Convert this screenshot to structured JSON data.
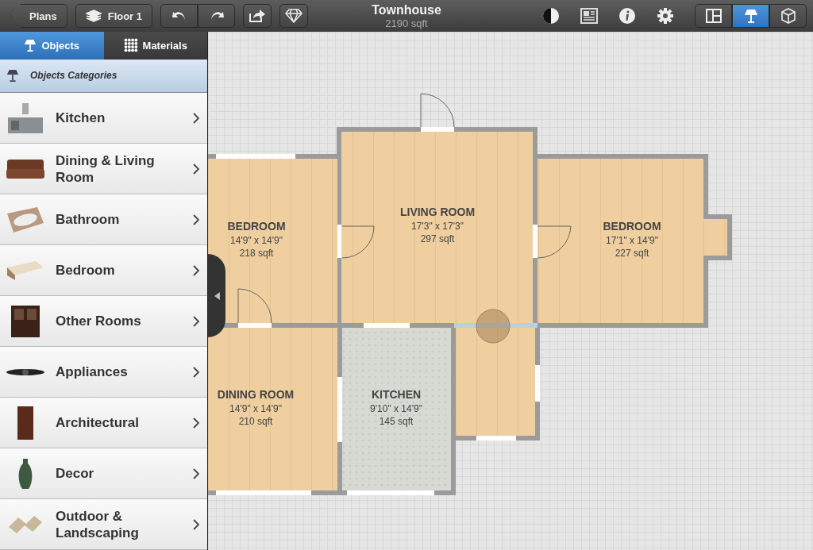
{
  "toolbar": {
    "back_button": "Plans",
    "floor_button": "Floor 1",
    "title": "Townhouse",
    "subtitle": "2190 sqft",
    "view_modes": [
      {
        "kind": "plan",
        "selected": false
      },
      {
        "kind": "objects",
        "selected": true
      },
      {
        "kind": "cube",
        "selected": false
      }
    ]
  },
  "sidebar": {
    "tabs": [
      {
        "label": "Objects",
        "kind": "objects",
        "selected": true
      },
      {
        "label": "Materials",
        "kind": "materials",
        "selected": false
      }
    ],
    "header": "Objects Categories",
    "categories": [
      {
        "label": "Kitchen",
        "kind": "kitchen"
      },
      {
        "label": "Dining & Living Room",
        "kind": "sofa"
      },
      {
        "label": "Bathroom",
        "kind": "bathtub"
      },
      {
        "label": "Bedroom",
        "kind": "bed"
      },
      {
        "label": "Other Rooms",
        "kind": "shelf"
      },
      {
        "label": "Appliances",
        "kind": "fan"
      },
      {
        "label": "Architectural",
        "kind": "door"
      },
      {
        "label": "Decor",
        "kind": "vase"
      },
      {
        "label": "Outdoor & Landscaping",
        "kind": "chairs"
      }
    ]
  },
  "plan": {
    "rooms": [
      {
        "name": "BEDROOM",
        "size": "14'9\" x 14'9\"",
        "area": "218 sqft",
        "kind": "wood"
      },
      {
        "name": "LIVING ROOM",
        "size": "17'3\" x 17'3\"",
        "area": "297 sqft",
        "kind": "wood"
      },
      {
        "name": "BEDROOM",
        "size": "17'1\" x 14'9\"",
        "area": "227 sqft",
        "kind": "wood"
      },
      {
        "name": "DINING ROOM",
        "size": "14'9\" x 14'9\"",
        "area": "210 sqft",
        "kind": "wood"
      },
      {
        "name": "KITCHEN",
        "size": "9'10\" x 14'9\"",
        "area": "145 sqft",
        "kind": "tile"
      },
      {
        "kind": "wood"
      }
    ]
  }
}
